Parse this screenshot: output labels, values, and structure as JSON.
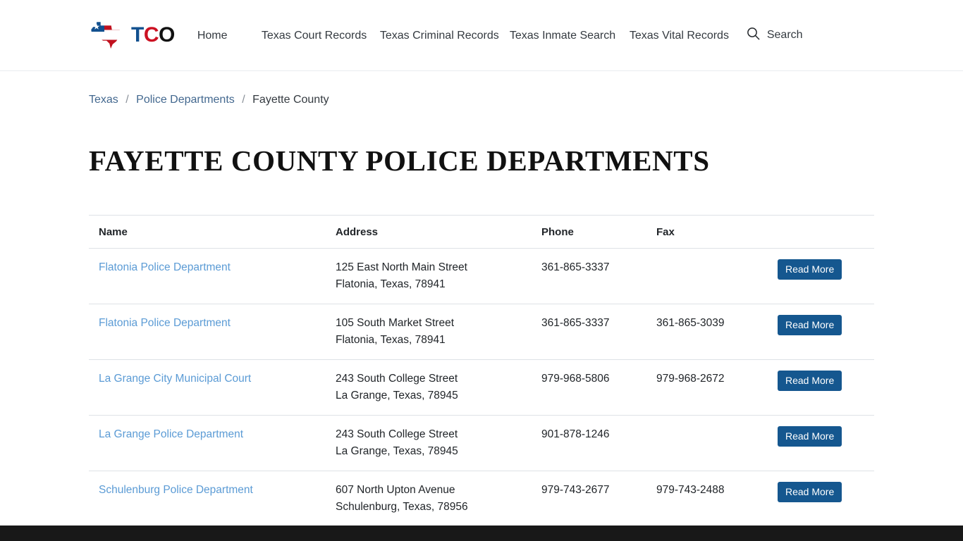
{
  "header": {
    "brand": {
      "icon": "texas-flag-state-logo",
      "letters": [
        {
          "char": "T",
          "color": "#12508f"
        },
        {
          "char": "C",
          "color": "#cc1122"
        },
        {
          "char": "O",
          "color": "#111111"
        }
      ]
    },
    "nav": [
      {
        "label": "Home",
        "key": "home"
      },
      {
        "label": "Texas Court Records",
        "key": "court"
      },
      {
        "label": "Texas Criminal Records",
        "key": "criminal"
      },
      {
        "label": "Texas Inmate Search",
        "key": "inmate"
      },
      {
        "label": "Texas Vital Records",
        "key": "vital"
      }
    ],
    "search": {
      "label": "Search",
      "icon": "search-icon"
    }
  },
  "breadcrumb": {
    "items": [
      {
        "label": "Texas",
        "link": true
      },
      {
        "label": "Police Departments",
        "link": true
      },
      {
        "label": "Fayette County",
        "link": false
      }
    ],
    "separator": "/"
  },
  "page": {
    "title": "FAYETTE COUNTY POLICE DEPARTMENTS"
  },
  "table": {
    "columns": [
      "Name",
      "Address",
      "Phone",
      "Fax",
      ""
    ],
    "action_label": "Read More",
    "rows": [
      {
        "name": "Flatonia Police Department",
        "street": "125 East North Main Street",
        "locality": "Flatonia, Texas, 78941",
        "phone": "361-865-3337",
        "fax": "",
        "action": "Read More"
      },
      {
        "name": "Flatonia Police Department",
        "street": "105 South Market Street",
        "locality": "Flatonia, Texas, 78941",
        "phone": "361-865-3337",
        "fax": "361-865-3039",
        "action": "Read More"
      },
      {
        "name": "La Grange City Municipal Court",
        "street": "243 South College Street",
        "locality": "La Grange, Texas, 78945",
        "phone": "979-968-5806",
        "fax": "979-968-2672",
        "action": "Read More"
      },
      {
        "name": "La Grange Police Department",
        "street": "243 South College Street",
        "locality": "La Grange, Texas, 78945",
        "phone": "901-878-1246",
        "fax": "",
        "action": "Read More"
      },
      {
        "name": "Schulenburg Police Department",
        "street": "607 North Upton Avenue",
        "locality": "Schulenburg, Texas, 78956",
        "phone": "979-743-2677",
        "fax": "979-743-2488",
        "action": "Read More"
      }
    ]
  },
  "colors": {
    "link": "#5b9bd5",
    "breadcrumb_link": "#43688f",
    "button": "#15578f",
    "footer": "#181818",
    "border": "#dee2e6"
  }
}
